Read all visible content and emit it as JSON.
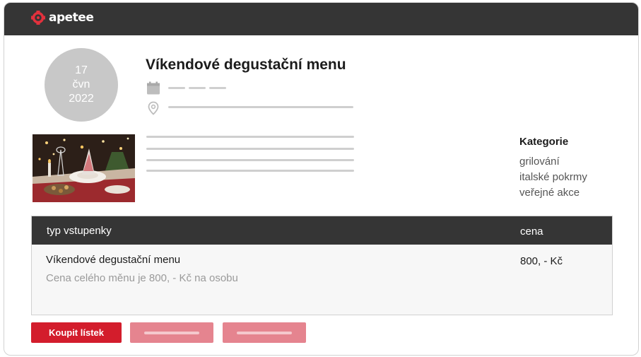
{
  "brand": {
    "name": "apetee",
    "accent": "#d31d2c",
    "dark": "#353535"
  },
  "event": {
    "date": {
      "day": "17",
      "month": "čvn",
      "year": "2022"
    },
    "title": "Víkendové degustační menu",
    "icons": {
      "date": "calendar-icon",
      "location": "location-pin-icon"
    }
  },
  "categories": {
    "heading": "Kategorie",
    "items": [
      "grilování",
      "italské pokrmy",
      "veřejné akce"
    ]
  },
  "tickets": {
    "headers": {
      "type": "typ vstupenky",
      "price": "cena"
    },
    "rows": [
      {
        "name": "Víkendové degustační menu",
        "description": "Cena celého měnu je 800, - Kč na osobu",
        "price": "800, - Kč"
      }
    ]
  },
  "actions": {
    "buy_label": "Koupit lístek"
  }
}
